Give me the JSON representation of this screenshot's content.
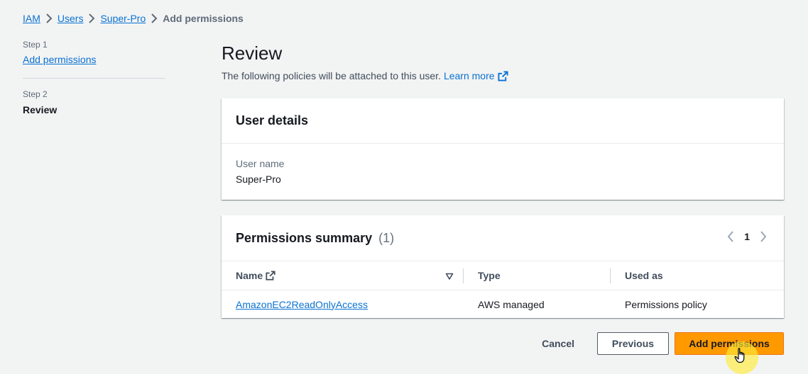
{
  "breadcrumb": {
    "items": [
      "IAM",
      "Users",
      "Super-Pro"
    ],
    "current": "Add permissions"
  },
  "steps": {
    "step1_label": "Step 1",
    "step1_title": "Add permissions",
    "step2_label": "Step 2",
    "step2_title": "Review"
  },
  "page": {
    "title": "Review",
    "description": "The following policies will be attached to this user.",
    "learn_more": "Learn more"
  },
  "user_details": {
    "title": "User details",
    "user_name_label": "User name",
    "user_name_value": "Super-Pro"
  },
  "permissions": {
    "title": "Permissions summary",
    "count": "(1)",
    "page_number": "1",
    "columns": [
      "Name",
      "Type",
      "Used as"
    ],
    "rows": [
      {
        "name": "AmazonEC2ReadOnlyAccess",
        "type": "AWS managed",
        "used_as": "Permissions policy"
      }
    ]
  },
  "actions": {
    "cancel": "Cancel",
    "previous": "Previous",
    "submit": "Add permissions"
  },
  "icons": {
    "breadcrumb_separator": "chevron-right-icon",
    "external_link": "external-link-icon",
    "pager_prev": "chevron-left-icon",
    "pager_next": "chevron-right-icon",
    "sort": "sort-down-icon",
    "cursor": "hand-pointer-icon"
  },
  "colors": {
    "link": "#0972d3",
    "primary_button": "#ff9900",
    "background": "#f2f3f3"
  }
}
